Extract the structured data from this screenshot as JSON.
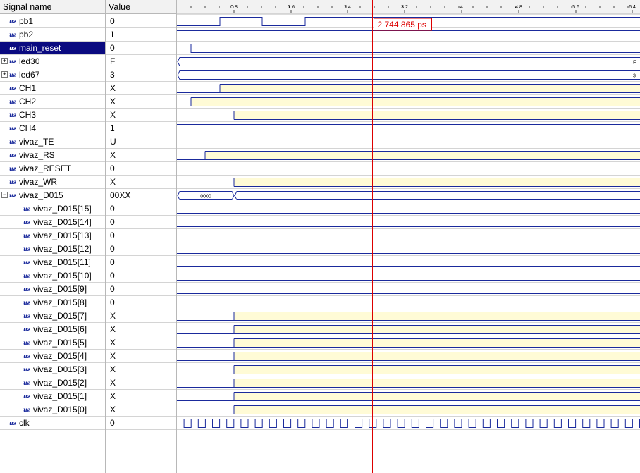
{
  "header": {
    "name_col": "Signal name",
    "value_col": "Value"
  },
  "timeline": {
    "tick_labels": [
      "0.8",
      "1.6",
      "2.4",
      "3.2",
      "4",
      "4.8",
      "5.6",
      "6.4"
    ],
    "tick_values": [
      0.8,
      1.6,
      2.4,
      3.2,
      4.0,
      4.8,
      5.6,
      6.4
    ],
    "cursor_value": 2.744865,
    "cursor_label": "2 744 865 ps"
  },
  "colors": {
    "wave": "#1a2a9c",
    "unknown_fill": "#fffbd6",
    "cursor": "#dd0000",
    "selection": "#0a0a80"
  },
  "signals": [
    {
      "name": "pb1",
      "value": "0",
      "icon": "signal-icon",
      "wave": {
        "type": "bit",
        "init": 0,
        "edges": [
          0.6,
          1.2,
          1.8
        ]
      }
    },
    {
      "name": "pb2",
      "value": "1",
      "icon": "signal-icon",
      "wave": {
        "type": "bit",
        "init": 1,
        "edges": []
      }
    },
    {
      "name": "main_reset",
      "value": "0",
      "icon": "signal-icon",
      "selected": true,
      "wave": {
        "type": "bit",
        "init": 1,
        "edges": [
          0.2
        ]
      }
    },
    {
      "name": "led30",
      "value": "F",
      "icon": "signal-icon",
      "expander": "+",
      "wave": {
        "type": "bus",
        "segments": [
          {
            "start": 0,
            "label": "F"
          }
        ]
      }
    },
    {
      "name": "led67",
      "value": "3",
      "icon": "signal-icon",
      "expander": "+",
      "wave": {
        "type": "bus",
        "segments": [
          {
            "start": 0,
            "label": "3"
          }
        ]
      }
    },
    {
      "name": "CH1",
      "value": "X",
      "icon": "signal-icon",
      "wave": {
        "type": "x",
        "init": 0,
        "xstart": 0.6
      }
    },
    {
      "name": "CH2",
      "value": "X",
      "icon": "signal-icon",
      "wave": {
        "type": "x",
        "init": 0,
        "xstart": 0.2
      }
    },
    {
      "name": "CH3",
      "value": "X",
      "icon": "signal-icon",
      "wave": {
        "type": "x",
        "init": 1,
        "xstart": 0.8
      }
    },
    {
      "name": "CH4",
      "value": "1",
      "icon": "signal-icon",
      "wave": {
        "type": "bit",
        "init": 1,
        "edges": []
      }
    },
    {
      "name": "vivaz_TE",
      "value": "U",
      "icon": "signal-icon",
      "wave": {
        "type": "u"
      }
    },
    {
      "name": "vivaz_RS",
      "value": "X",
      "icon": "signal-icon",
      "wave": {
        "type": "x",
        "init": 0,
        "xstart": 0.4
      }
    },
    {
      "name": "vivaz_RESET",
      "value": "0",
      "icon": "signal-icon",
      "wave": {
        "type": "bit",
        "init": 0,
        "edges": []
      }
    },
    {
      "name": "vivaz_WR",
      "value": "X",
      "icon": "signal-icon",
      "wave": {
        "type": "x",
        "init": 1,
        "xstart": 0.8
      }
    },
    {
      "name": "vivaz_D015",
      "value": "00XX",
      "icon": "signal-icon",
      "expander": "−",
      "wave": {
        "type": "bus",
        "segments": [
          {
            "start": 0,
            "label": "0000"
          },
          {
            "start": 0.8,
            "label": ""
          }
        ]
      }
    },
    {
      "name": "vivaz_D015[15]",
      "value": "0",
      "icon": "signal-icon",
      "child": true,
      "wave": {
        "type": "bit",
        "init": 0,
        "edges": []
      }
    },
    {
      "name": "vivaz_D015[14]",
      "value": "0",
      "icon": "signal-icon",
      "child": true,
      "wave": {
        "type": "bit",
        "init": 0,
        "edges": []
      }
    },
    {
      "name": "vivaz_D015[13]",
      "value": "0",
      "icon": "signal-icon",
      "child": true,
      "wave": {
        "type": "bit",
        "init": 0,
        "edges": []
      }
    },
    {
      "name": "vivaz_D015[12]",
      "value": "0",
      "icon": "signal-icon",
      "child": true,
      "wave": {
        "type": "bit",
        "init": 0,
        "edges": []
      }
    },
    {
      "name": "vivaz_D015[11]",
      "value": "0",
      "icon": "signal-icon",
      "child": true,
      "wave": {
        "type": "bit",
        "init": 0,
        "edges": []
      }
    },
    {
      "name": "vivaz_D015[10]",
      "value": "0",
      "icon": "signal-icon",
      "child": true,
      "wave": {
        "type": "bit",
        "init": 0,
        "edges": []
      }
    },
    {
      "name": "vivaz_D015[9]",
      "value": "0",
      "icon": "signal-icon",
      "child": true,
      "wave": {
        "type": "bit",
        "init": 0,
        "edges": []
      }
    },
    {
      "name": "vivaz_D015[8]",
      "value": "0",
      "icon": "signal-icon",
      "child": true,
      "wave": {
        "type": "bit",
        "init": 0,
        "edges": []
      }
    },
    {
      "name": "vivaz_D015[7]",
      "value": "X",
      "icon": "signal-icon",
      "child": true,
      "wave": {
        "type": "x",
        "init": 0,
        "xstart": 0.8
      }
    },
    {
      "name": "vivaz_D015[6]",
      "value": "X",
      "icon": "signal-icon",
      "child": true,
      "wave": {
        "type": "x",
        "init": 0,
        "xstart": 0.8
      }
    },
    {
      "name": "vivaz_D015[5]",
      "value": "X",
      "icon": "signal-icon",
      "child": true,
      "wave": {
        "type": "x",
        "init": 0,
        "xstart": 0.8
      }
    },
    {
      "name": "vivaz_D015[4]",
      "value": "X",
      "icon": "signal-icon",
      "child": true,
      "wave": {
        "type": "x",
        "init": 0,
        "xstart": 0.8
      }
    },
    {
      "name": "vivaz_D015[3]",
      "value": "X",
      "icon": "signal-icon",
      "child": true,
      "wave": {
        "type": "x",
        "init": 0,
        "xstart": 0.8
      }
    },
    {
      "name": "vivaz_D015[2]",
      "value": "X",
      "icon": "signal-icon",
      "child": true,
      "wave": {
        "type": "x",
        "init": 0,
        "xstart": 0.8
      }
    },
    {
      "name": "vivaz_D015[1]",
      "value": "X",
      "icon": "signal-icon",
      "child": true,
      "wave": {
        "type": "x",
        "init": 0,
        "xstart": 0.8
      }
    },
    {
      "name": "vivaz_D015[0]",
      "value": "X",
      "icon": "signal-icon",
      "child": true,
      "wave": {
        "type": "x",
        "init": 0,
        "xstart": 0.8
      }
    },
    {
      "name": "clk",
      "value": "0",
      "icon": "signal-icon",
      "wave": {
        "type": "clock",
        "half_period": 0.1,
        "init": 1
      }
    }
  ]
}
